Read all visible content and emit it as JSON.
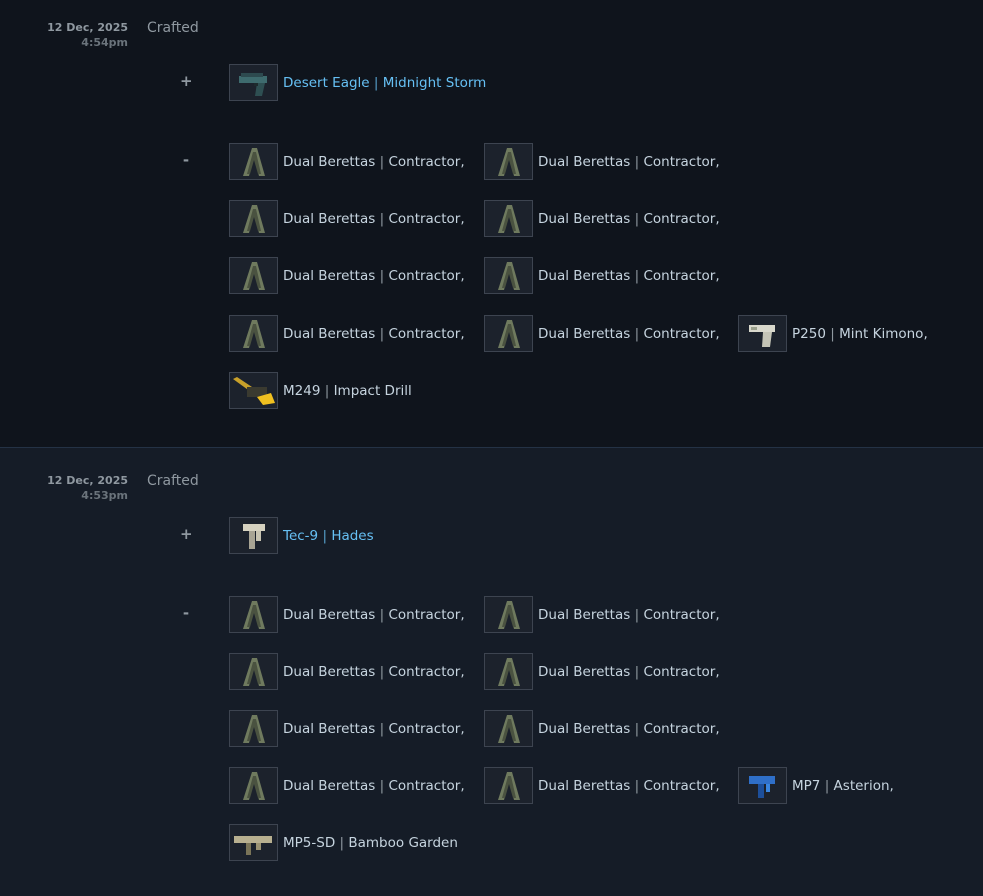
{
  "entries": [
    {
      "date": "12 Dec, 2025",
      "time": "4:54pm",
      "action": "Crafted",
      "plus": "+",
      "minus": "-",
      "gained": [
        {
          "weapon": "Desert Eagle",
          "skin": "Midnight Storm",
          "icon": "deagle-icon"
        }
      ],
      "lost": [
        {
          "weapon": "Dual Berettas",
          "skin": "Contractor,",
          "icon": "dual-berettas-icon"
        },
        {
          "weapon": "Dual Berettas",
          "skin": "Contractor,",
          "icon": "dual-berettas-icon"
        },
        {
          "weapon": "Dual Berettas",
          "skin": "Contractor,",
          "icon": "dual-berettas-icon"
        },
        {
          "weapon": "Dual Berettas",
          "skin": "Contractor,",
          "icon": "dual-berettas-icon"
        },
        {
          "weapon": "Dual Berettas",
          "skin": "Contractor,",
          "icon": "dual-berettas-icon"
        },
        {
          "weapon": "Dual Berettas",
          "skin": "Contractor,",
          "icon": "dual-berettas-icon"
        },
        {
          "weapon": "Dual Berettas",
          "skin": "Contractor,",
          "icon": "dual-berettas-icon"
        },
        {
          "weapon": "Dual Berettas",
          "skin": "Contractor,",
          "icon": "dual-berettas-icon"
        },
        {
          "weapon": "P250",
          "skin": "Mint Kimono,",
          "icon": "p250-icon"
        },
        {
          "weapon": "M249",
          "skin": "Impact Drill",
          "icon": "m249-icon"
        }
      ]
    },
    {
      "date": "12 Dec, 2025",
      "time": "4:53pm",
      "action": "Crafted",
      "plus": "+",
      "minus": "-",
      "gained": [
        {
          "weapon": "Tec-9",
          "skin": "Hades",
          "icon": "tec9-icon"
        }
      ],
      "lost": [
        {
          "weapon": "Dual Berettas",
          "skin": "Contractor,",
          "icon": "dual-berettas-icon"
        },
        {
          "weapon": "Dual Berettas",
          "skin": "Contractor,",
          "icon": "dual-berettas-icon"
        },
        {
          "weapon": "Dual Berettas",
          "skin": "Contractor,",
          "icon": "dual-berettas-icon"
        },
        {
          "weapon": "Dual Berettas",
          "skin": "Contractor,",
          "icon": "dual-berettas-icon"
        },
        {
          "weapon": "Dual Berettas",
          "skin": "Contractor,",
          "icon": "dual-berettas-icon"
        },
        {
          "weapon": "Dual Berettas",
          "skin": "Contractor,",
          "icon": "dual-berettas-icon"
        },
        {
          "weapon": "Dual Berettas",
          "skin": "Contractor,",
          "icon": "dual-berettas-icon"
        },
        {
          "weapon": "Dual Berettas",
          "skin": "Contractor,",
          "icon": "dual-berettas-icon"
        },
        {
          "weapon": "MP7",
          "skin": "Asterion,",
          "icon": "mp7-icon"
        },
        {
          "weapon": "MP5-SD",
          "skin": "Bamboo Garden",
          "icon": "mp5sd-icon"
        }
      ]
    }
  ],
  "separator": "|",
  "colors": {
    "gained_text": "#66c0f4",
    "lost_text": "#c6d4df",
    "entry_bg_1": "#0f141c",
    "entry_bg_2": "#151c27"
  }
}
